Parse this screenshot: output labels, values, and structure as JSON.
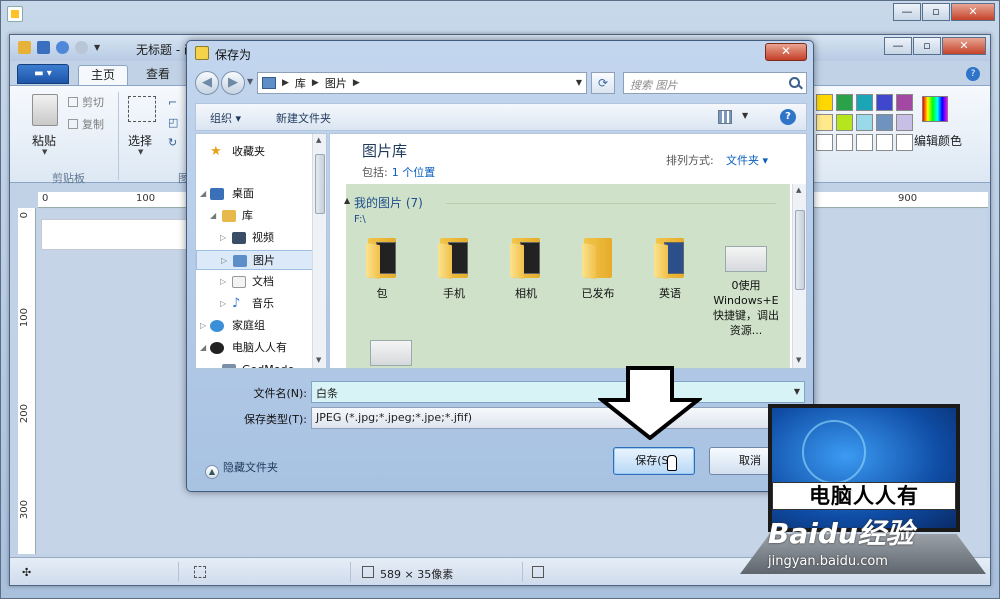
{
  "paint": {
    "title": "无标题 - 画图",
    "tabs": [
      "主页",
      "查看"
    ],
    "ribbon": {
      "paste_label": "粘贴",
      "cut_label": "剪切",
      "copy_label": "复制",
      "clipboard_group": "剪贴板",
      "select_label": "选择",
      "image_group_partial": "图",
      "edit_colors_label": "编辑颜色",
      "palette": [
        "#ffd800",
        "#2aa24a",
        "#1aa6b7",
        "#3f48cc",
        "#a349a4",
        "#ffe98a",
        "#b5e61d",
        "#99d9ea",
        "#7092be",
        "#c8bfe7",
        "#ffffff",
        "#ffffff",
        "#ffffff",
        "#ffffff",
        "#ffffff",
        "#ffffff",
        "#ffffff",
        "#ffffff",
        "#ffffff",
        "#ffffff"
      ]
    },
    "ruler_h": [
      "0",
      "100",
      "900"
    ],
    "ruler_v": [
      "0",
      "100",
      "200",
      "300"
    ],
    "status": {
      "size_text": "589 × 35像素"
    }
  },
  "dialog": {
    "title": "保存为",
    "breadcrumbs": [
      "库",
      "图片"
    ],
    "search_placeholder": "搜索 图片",
    "toolbar": {
      "organize": "组织 ▾",
      "new_folder": "新建文件夹"
    },
    "nav": [
      {
        "label": "收藏夹",
        "icon": "star-icon"
      },
      {
        "label": "桌面",
        "icon": "desktop-icon"
      },
      {
        "label": "库",
        "icon": "library-icon"
      },
      {
        "label": "视频",
        "icon": "video-icon"
      },
      {
        "label": "图片",
        "icon": "pictures-icon"
      },
      {
        "label": "文档",
        "icon": "document-icon"
      },
      {
        "label": "音乐",
        "icon": "music-icon"
      },
      {
        "label": "家庭组",
        "icon": "homegroup-icon"
      },
      {
        "label": "电脑人人有",
        "icon": "user-icon"
      },
      {
        "label": "GodMode",
        "icon": "folder-icon"
      }
    ],
    "library": {
      "title": "图片库",
      "includes_label": "包括:",
      "includes_value": "1 个位置",
      "arrange_label": "排列方式:",
      "arrange_value": "文件夹 ▾"
    },
    "group": {
      "title": "我的图片 (7)",
      "path": "F:\\"
    },
    "files": [
      "包",
      "手机",
      "相机",
      "已发布",
      "英语"
    ],
    "thumb_file": "0使用Windows+E快捷键，调出资源...",
    "filename_label": "文件名(N):",
    "filename_value": "白条",
    "filetype_label": "保存类型(T):",
    "filetype_value": "JPEG (*.jpg;*.jpeg;*.jpe;*.jfif)",
    "hide_folders": "隐藏文件夹",
    "save_button": "保存(S)",
    "cancel_button": "取消"
  },
  "overlay": {
    "logo_text": "电脑人人有",
    "baidu_text": "Baidu经验",
    "baidu_url": "jingyan.baidu.com"
  }
}
